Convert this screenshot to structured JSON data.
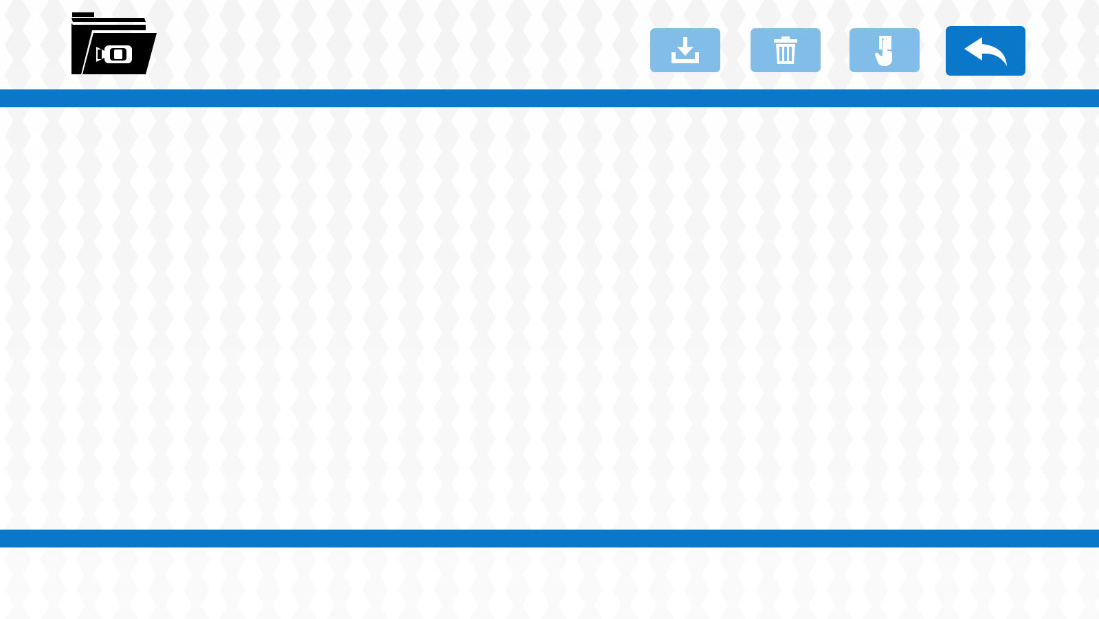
{
  "header": {
    "logo_icon": "folder-video-icon"
  },
  "toolbar": {
    "buttons": [
      {
        "name": "download",
        "icon": "download-icon",
        "enabled": false
      },
      {
        "name": "delete",
        "icon": "trash-icon",
        "enabled": false
      },
      {
        "name": "touch",
        "icon": "hand-pointer-icon",
        "enabled": false
      },
      {
        "name": "back",
        "icon": "back-arrow-icon",
        "enabled": true
      }
    ]
  },
  "content": {
    "empty_text": ""
  },
  "colors": {
    "accent": "#0b77c9",
    "disabled_button": "#81bde6",
    "background": "#f7f7f7",
    "icon_white": "#ffffff",
    "logo": "#000000"
  }
}
